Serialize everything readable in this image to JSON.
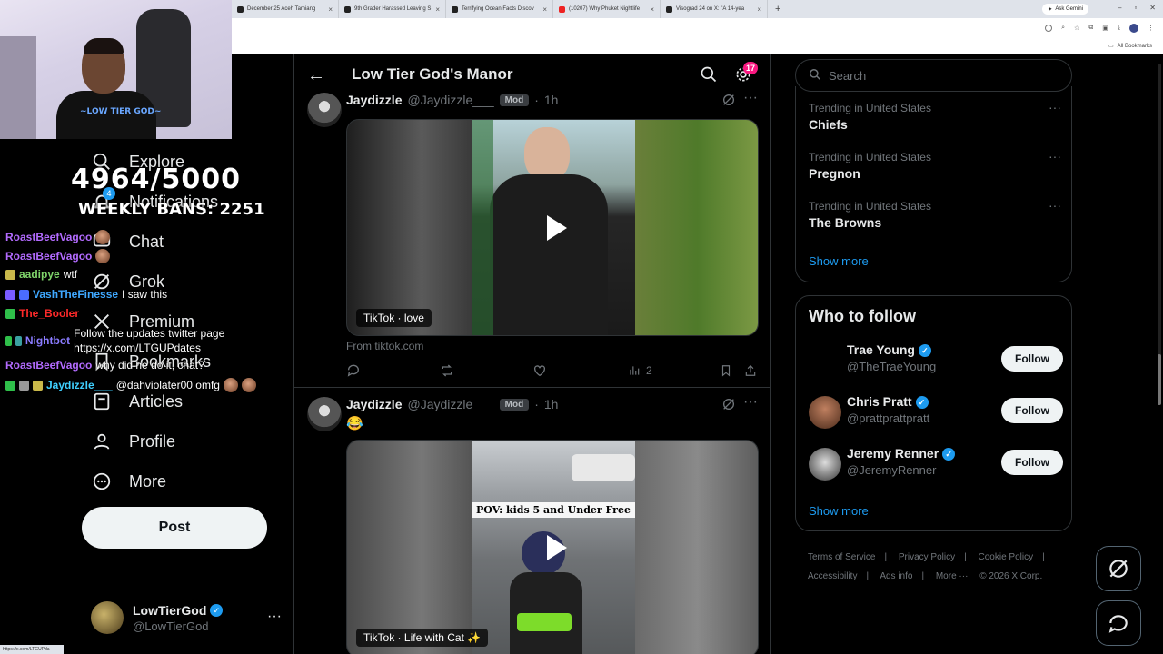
{
  "browser": {
    "tabs": [
      {
        "label": "December 25 Aceh Tamiang"
      },
      {
        "label": "9th Grader Harassed Leaving S"
      },
      {
        "label": "Terrifying Ocean Facts Discov"
      },
      {
        "label": "(10207) Why Phuket Nightlife"
      },
      {
        "label": "Visograd 24 on X: \"A 14-yea"
      }
    ],
    "new_tab": "+",
    "gemini": "Ask Gemini",
    "bookmarks_label": "All Bookmarks"
  },
  "overlay": {
    "counter": "4964/5000",
    "weekly_bans": "WEEKLY BANS: 2251",
    "chat": [
      {
        "user": "RoastBeefVagoo",
        "msg": "",
        "color": "#b36bff"
      },
      {
        "user": "RoastBeefVagoo",
        "msg": "",
        "color": "#b36bff"
      },
      {
        "user": "aadipye",
        "msg": "wtf",
        "color": "#7fd46a"
      },
      {
        "user": "VashTheFinesse",
        "msg": "I saw this",
        "color": "#3fa8ff"
      },
      {
        "user": "The_Booler",
        "msg": "",
        "color": "#ff2a2a"
      },
      {
        "user": "Nightbot",
        "msg": "Follow the updates twitter page https://x.com/LTGUPdates",
        "color": "#8a7bff"
      },
      {
        "user": "RoastBeefVagoo",
        "msg": "why did he do it, chat?",
        "color": "#b36bff"
      },
      {
        "user": "Jaydizzle___",
        "msg": "@dahviolater00 omfg",
        "color": "#3fd0ff"
      }
    ],
    "status_url": "https://x.com/LTGUPda"
  },
  "nav": {
    "items": [
      {
        "label": "Explore",
        "icon": "search-icon"
      },
      {
        "label": "Notifications",
        "icon": "bell-icon"
      },
      {
        "label": "Chat",
        "icon": "chat-icon"
      },
      {
        "label": "Grok",
        "icon": "grok-icon"
      },
      {
        "label": "Premium",
        "icon": "x-logo-icon"
      },
      {
        "label": "Bookmarks",
        "icon": "bookmark-icon"
      },
      {
        "label": "Articles",
        "icon": "article-icon"
      },
      {
        "label": "Profile",
        "icon": "person-icon"
      },
      {
        "label": "More",
        "icon": "more-circle-icon"
      }
    ],
    "notif_badge": "4",
    "post_label": "Post",
    "account": {
      "name": "LowTierGod",
      "handle": "@LowTierGod",
      "more": "···"
    }
  },
  "community": {
    "title": "Low Tier God's Manor",
    "badge": "17",
    "posts": [
      {
        "name": "Jaydizzle",
        "handle": "@Jaydizzle___",
        "mod": "Mod",
        "time": "1h",
        "text": "",
        "media_label": "TikTok · love",
        "from": "From tiktok.com",
        "views": "2"
      },
      {
        "name": "Jaydizzle",
        "handle": "@Jaydizzle___",
        "mod": "Mod",
        "time": "1h",
        "text": "😂",
        "media_caption": "POV: kids 5 and Under Free",
        "media_label": "TikTok · Life with Cat ✨"
      }
    ]
  },
  "sidebar": {
    "search_placeholder": "Search",
    "trends": [
      {
        "context": "Trending in United States",
        "title": "Chiefs"
      },
      {
        "context": "Trending in United States",
        "title": "Pregnon"
      },
      {
        "context": "Trending in United States",
        "title": "The Browns"
      }
    ],
    "show_more": "Show more",
    "who_to_follow": "Who to follow",
    "follows": [
      {
        "name": "Trae Young",
        "handle": "@TheTraeYoung",
        "button": "Follow"
      },
      {
        "name": "Chris Pratt",
        "handle": "@prattprattpratt",
        "button": "Follow"
      },
      {
        "name": "Jeremy Renner",
        "handle": "@JeremyRenner",
        "button": "Follow"
      }
    ],
    "show_more_2": "Show more",
    "footer": [
      "Terms of Service",
      "Privacy Policy",
      "Cookie Policy",
      "Accessibility",
      "Ads info",
      "More ···",
      "© 2026 X Corp."
    ]
  },
  "colors": {
    "accent": "#1d9bf0",
    "background": "#000000",
    "border": "#2f3336",
    "muted": "#71767b",
    "verified": "#1d9bf0",
    "notif": "#f91880"
  }
}
